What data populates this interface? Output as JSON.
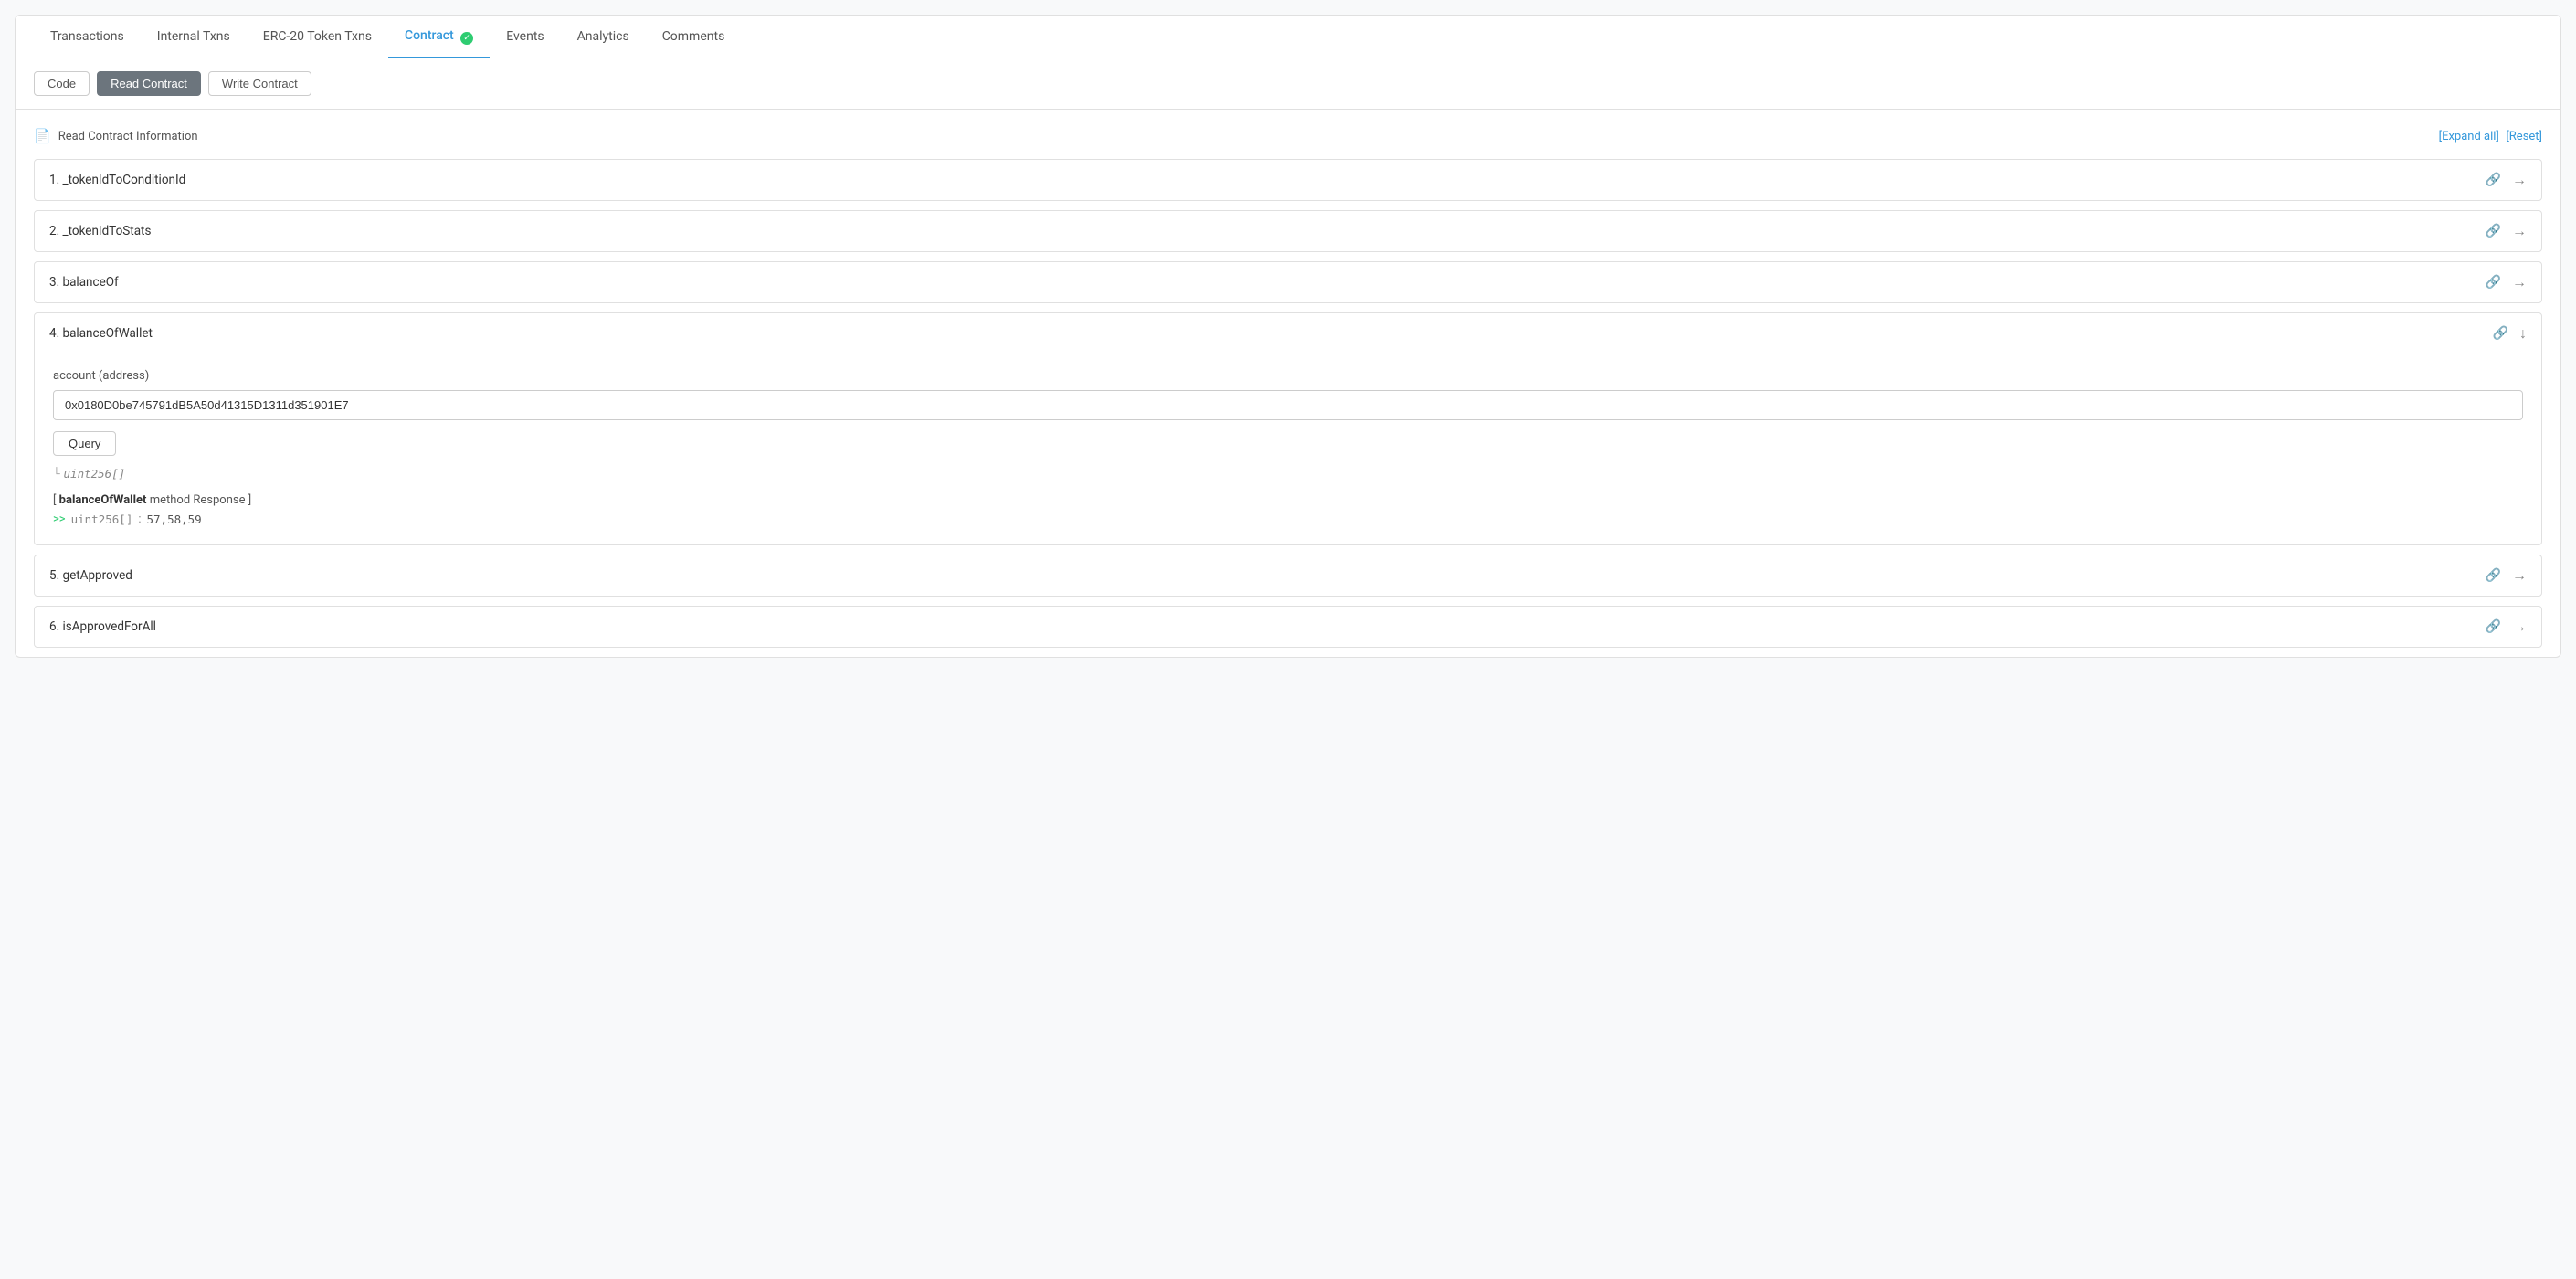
{
  "tabs": [
    {
      "id": "transactions",
      "label": "Transactions",
      "active": false
    },
    {
      "id": "internal-txns",
      "label": "Internal Txns",
      "active": false
    },
    {
      "id": "erc20-token-txns",
      "label": "ERC-20 Token Txns",
      "active": false
    },
    {
      "id": "contract",
      "label": "Contract",
      "active": true,
      "verified": true
    },
    {
      "id": "events",
      "label": "Events",
      "active": false
    },
    {
      "id": "analytics",
      "label": "Analytics",
      "active": false
    },
    {
      "id": "comments",
      "label": "Comments",
      "active": false
    }
  ],
  "sub_tabs": [
    {
      "id": "code",
      "label": "Code",
      "active": false
    },
    {
      "id": "read-contract",
      "label": "Read Contract",
      "active": true
    },
    {
      "id": "write-contract",
      "label": "Write Contract",
      "active": false
    }
  ],
  "section": {
    "title": "Read Contract Information",
    "expand_all_label": "[Expand all]",
    "reset_label": "[Reset]"
  },
  "contract_items": [
    {
      "id": 1,
      "name": "_tokenIdToConditionId",
      "expanded": false
    },
    {
      "id": 2,
      "name": "_tokenIdToStats",
      "expanded": false
    },
    {
      "id": 3,
      "name": "balanceOf",
      "expanded": false
    },
    {
      "id": 4,
      "name": "balanceOfWallet",
      "expanded": true,
      "param_label": "account (address)",
      "param_value": "0x0180D0be745791dB5A50d41315D1311d351901E7",
      "param_placeholder": "",
      "query_label": "Query",
      "return_type": "uint256[]",
      "response_method": "balanceOfWallet",
      "response_key": "uint256[]",
      "response_value": "57,58,59"
    },
    {
      "id": 5,
      "name": "getApproved",
      "expanded": false
    },
    {
      "id": 6,
      "name": "isApprovedForAll",
      "expanded": false
    }
  ],
  "icons": {
    "link": "🔗",
    "arrow_right": "→",
    "arrow_down": "↓",
    "doc": "📄",
    "check": "✓",
    "response_arrow": ">>"
  }
}
